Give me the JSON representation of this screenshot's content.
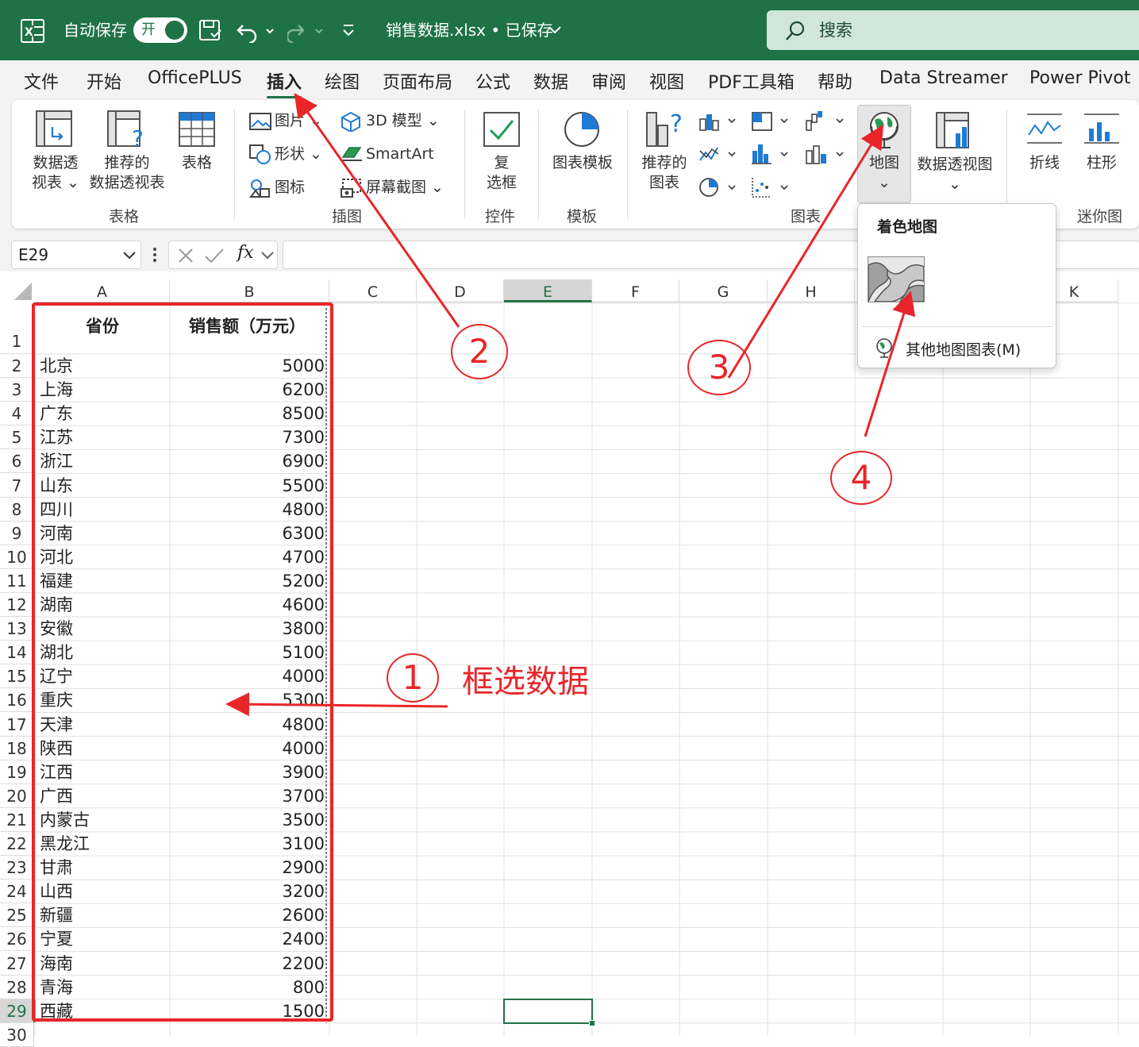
{
  "titlebar": {
    "autosave_label": "自动保存",
    "autosave_state": "开",
    "file_title": "销售数据.xlsx • 已保存",
    "search_placeholder": "搜索"
  },
  "tabs": [
    "文件",
    "开始",
    "OfficePLUS",
    "插入",
    "绘图",
    "页面布局",
    "公式",
    "数据",
    "审阅",
    "视图",
    "PDF工具箱",
    "帮助",
    "Data Streamer",
    "Power Pivot"
  ],
  "active_tab": "插入",
  "ribbon": {
    "tables": {
      "pivot": "数据透\n视表 ⌄",
      "recommended_pivot": "推荐的\n数据透视表",
      "table": "表格",
      "group": "表格"
    },
    "illustrations": {
      "pictures": "图片 ⌄",
      "shapes": "形状 ⌄",
      "icons": "图标",
      "models3d": "3D 模型 ⌄",
      "smartart": "SmartArt",
      "screenshot": "屏幕截图 ⌄",
      "group": "插图"
    },
    "controls": {
      "checkbox": "复\n选框",
      "group": "控件"
    },
    "templates": {
      "chart_template": "图表模板",
      "group": "模板"
    },
    "charts": {
      "recommended": "推荐的\n图表",
      "maps": "地图\n⌄",
      "pivot_chart": "数据透视图\n⌄",
      "group": "图表"
    },
    "sparklines": {
      "line": "折线",
      "column": "柱形",
      "group": "迷你图"
    }
  },
  "dropdown": {
    "heading": "着色地图",
    "more": "其他地图图表(M)"
  },
  "formula_bar": {
    "name_box": "E29",
    "fx": "fx",
    "value": ""
  },
  "columns": [
    "A",
    "B",
    "C",
    "D",
    "E",
    "F",
    "G",
    "H",
    "I",
    "J",
    "K"
  ],
  "selected_column": "E",
  "selected_row": "29",
  "header": {
    "province": "省份",
    "sales": "销售额（万元）"
  },
  "rows": [
    {
      "province": "北京",
      "sales": "5000"
    },
    {
      "province": "上海",
      "sales": "6200"
    },
    {
      "province": "广东",
      "sales": "8500"
    },
    {
      "province": "江苏",
      "sales": "7300"
    },
    {
      "province": "浙江",
      "sales": "6900"
    },
    {
      "province": "山东",
      "sales": "5500"
    },
    {
      "province": "四川",
      "sales": "4800"
    },
    {
      "province": "河南",
      "sales": "6300"
    },
    {
      "province": "河北",
      "sales": "4700"
    },
    {
      "province": "福建",
      "sales": "5200"
    },
    {
      "province": "湖南",
      "sales": "4600"
    },
    {
      "province": "安徽",
      "sales": "3800"
    },
    {
      "province": "湖北",
      "sales": "5100"
    },
    {
      "province": "辽宁",
      "sales": "4000"
    },
    {
      "province": "重庆",
      "sales": "5300"
    },
    {
      "province": "天津",
      "sales": "4800"
    },
    {
      "province": "陕西",
      "sales": "4000"
    },
    {
      "province": "江西",
      "sales": "3900"
    },
    {
      "province": "广西",
      "sales": "3700"
    },
    {
      "province": "内蒙古",
      "sales": "3500"
    },
    {
      "province": "黑龙江",
      "sales": "3100"
    },
    {
      "province": "甘肃",
      "sales": "2900"
    },
    {
      "province": "山西",
      "sales": "3200"
    },
    {
      "province": "新疆",
      "sales": "2600"
    },
    {
      "province": "宁夏",
      "sales": "2400"
    },
    {
      "province": "海南",
      "sales": "2200"
    },
    {
      "province": "青海",
      "sales": "800"
    },
    {
      "province": "西藏",
      "sales": "1500"
    }
  ],
  "annotations": {
    "step1": "1",
    "step1_text": "框选数据",
    "step2": "2",
    "step3": "3",
    "step4": "4",
    "color": "#e8262a"
  },
  "colors": {
    "excel_green": "#1f7246",
    "selection_green": "#217346",
    "annotation_red": "#e8262a"
  }
}
